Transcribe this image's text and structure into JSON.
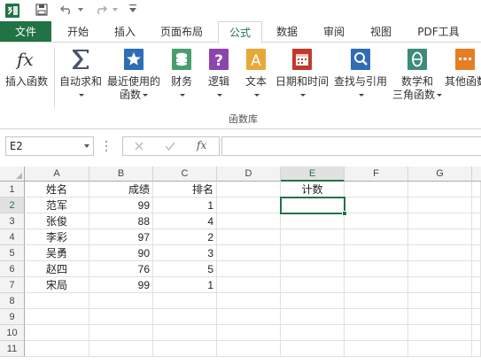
{
  "tabs": {
    "file": "文件",
    "home": "开始",
    "insert": "插入",
    "page_layout": "页面布局",
    "formulas": "公式",
    "data": "数据",
    "review": "审阅",
    "view": "视图",
    "pdf_tools": "PDF工具"
  },
  "ribbon": {
    "insert_function": "插入函数",
    "autosum": "自动求和",
    "recently_used_1": "最近使用的",
    "recently_used_2": "函数",
    "financial": "财务",
    "logical": "逻辑",
    "text": "文本",
    "date_time": "日期和时间",
    "lookup_ref": "查找与引用",
    "math_trig_1": "数学和",
    "math_trig_2": "三角函数",
    "more_functions": "其他函数",
    "group_label": "函数库"
  },
  "formula_bar": {
    "name_box": "E2",
    "fx": "fx",
    "content": ""
  },
  "columns": [
    "A",
    "B",
    "C",
    "D",
    "E",
    "F",
    "G"
  ],
  "rows": [
    "1",
    "2",
    "3",
    "4",
    "5",
    "6",
    "7",
    "8",
    "9",
    "10",
    "11"
  ],
  "sheet": {
    "A": [
      "姓名",
      "范军",
      "张俊",
      "李彩",
      "吴勇",
      "赵四",
      "宋局"
    ],
    "B": [
      "成绩",
      "99",
      "88",
      "97",
      "90",
      "76",
      "99"
    ],
    "C": [
      "排名",
      "1",
      "4",
      "2",
      "3",
      "5",
      "1"
    ],
    "E1": "计数"
  },
  "colors": {
    "accent": "#217346",
    "sum_icon": "#4a5568",
    "recent_icon": "#2f6db5",
    "financial_icon": "#4a9e6d",
    "logical_icon": "#8e44ad",
    "text_icon": "#e8a838",
    "datetime_icon": "#c0392b",
    "lookup_icon": "#2f6db5",
    "math_icon": "#3d8b7a",
    "more_icon": "#e67e22"
  }
}
